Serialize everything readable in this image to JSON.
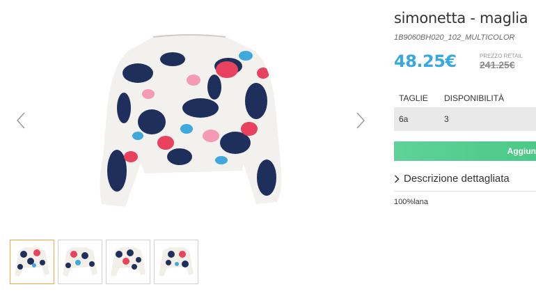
{
  "product": {
    "title": "simonetta - maglia",
    "sku": "1B9060BH020_102_MULTICOLOR",
    "price": "48.25€",
    "retail_label": "PREZZO RETAIL",
    "retail_price": "241.25€"
  },
  "sizes": {
    "headers": [
      "TAGLIE",
      "DISPONIBILITÀ"
    ],
    "rows": [
      {
        "size": "6a",
        "availability": "3"
      }
    ]
  },
  "cart": {
    "button_label": "Aggiungi al c"
  },
  "description": {
    "toggle_label": "Descrizione dettagliata",
    "text": "100%lana"
  },
  "gallery": {
    "thumbnail_count": 4,
    "active_thumbnail": 1
  },
  "colors": {
    "price": "#3aa8e0",
    "cart_button": "#55cd8f",
    "active_thumb_border": "#f0a540"
  }
}
